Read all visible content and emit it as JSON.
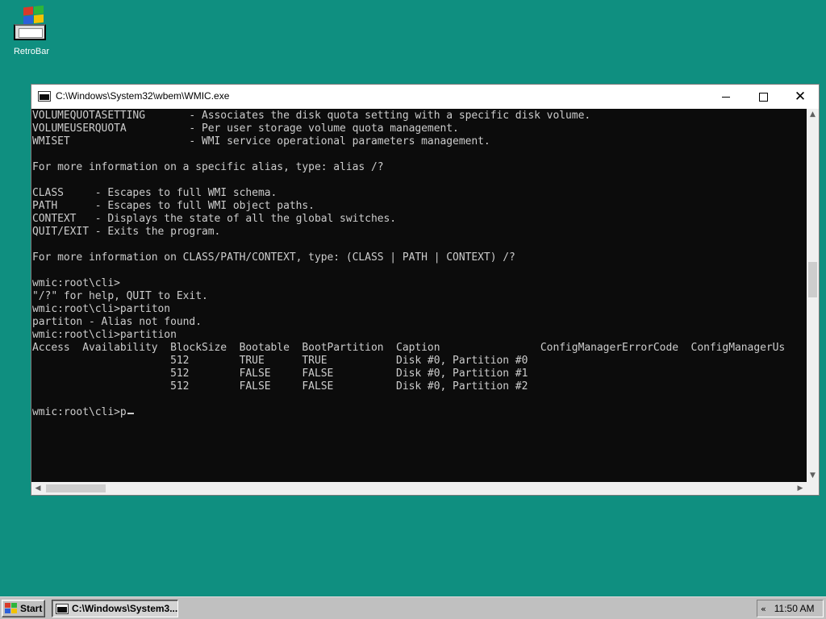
{
  "desktop": {
    "icons": [
      {
        "label": "RetroBar",
        "icon": "retrobar-icon"
      }
    ],
    "background_color": "#0f8f80"
  },
  "window": {
    "title": "C:\\Windows\\System32\\wbem\\WMIC.exe",
    "icon": "console-icon",
    "buttons": {
      "minimize": "minimize-icon",
      "maximize": "maximize-icon",
      "close": "close-icon"
    }
  },
  "console": {
    "text_color": "#cccccc",
    "background_color": "#0c0c0c",
    "lines": [
      "VOLUMEQUOTASETTING       - Associates the disk quota setting with a specific disk volume.",
      "VOLUMEUSERQUOTA          - Per user storage volume quota management.",
      "WMISET                   - WMI service operational parameters management.",
      "",
      "For more information on a specific alias, type: alias /?",
      "",
      "CLASS     - Escapes to full WMI schema.",
      "PATH      - Escapes to full WMI object paths.",
      "CONTEXT   - Displays the state of all the global switches.",
      "QUIT/EXIT - Exits the program.",
      "",
      "For more information on CLASS/PATH/CONTEXT, type: (CLASS | PATH | CONTEXT) /?",
      "",
      "wmic:root\\cli>",
      "\"/?\" for help, QUIT to Exit.",
      "wmic:root\\cli>partiton",
      "partiton - Alias not found.",
      "wmic:root\\cli>partition",
      "Access  Availability  BlockSize  Bootable  BootPartition  Caption                ConfigManagerErrorCode  ConfigManagerUs",
      "                      512        TRUE      TRUE           Disk #0, Partition #0",
      "                      512        FALSE     FALSE          Disk #0, Partition #1",
      "                      512        FALSE     FALSE          Disk #0, Partition #2",
      "",
      "wmic:root\\cli>p"
    ]
  },
  "scrollbars": {
    "vertical": {
      "up": "▲",
      "down": "▼"
    },
    "horizontal": {
      "left": "◀",
      "right": "▶"
    }
  },
  "taskbar": {
    "start_label": "Start",
    "task_label": "C:\\Windows\\System3...",
    "tray_chevron": "«",
    "clock": "11:50 AM"
  }
}
